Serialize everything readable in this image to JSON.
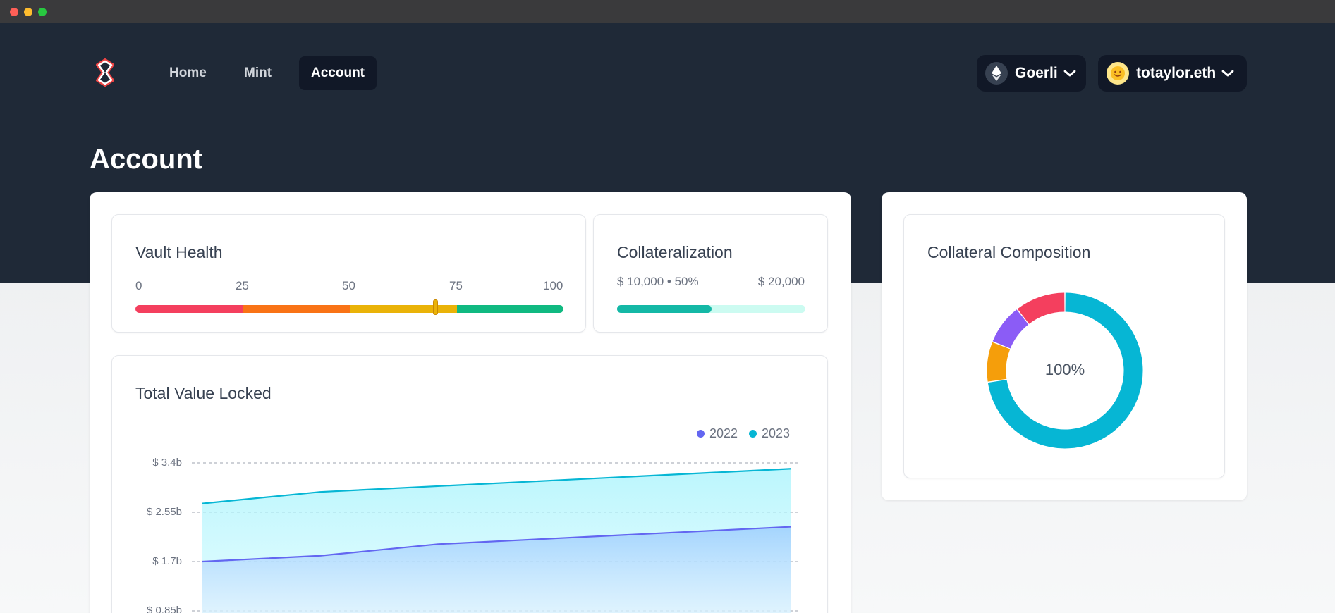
{
  "nav": {
    "items": [
      {
        "label": "Home"
      },
      {
        "label": "Mint"
      },
      {
        "label": "Account"
      }
    ],
    "network_label": "Goerli",
    "account_label": "totaylor.eth"
  },
  "page": {
    "title": "Account"
  },
  "vault_health": {
    "title": "Vault Health",
    "ticks": [
      "0",
      "25",
      "50",
      "75",
      "100"
    ],
    "value": 70,
    "colors": [
      "#f43f5e",
      "#f97316",
      "#eab308",
      "#10b981"
    ]
  },
  "collateralization": {
    "title": "Collateralization",
    "current_label": "$ 10,000 • 50%",
    "max_label": "$ 20,000",
    "percent": 50,
    "fill_color": "#14b8a6",
    "track_color": "#ccfbf1"
  },
  "composition": {
    "title": "Collateral Composition",
    "center_label": "100%",
    "colors": [
      "#06b6d4",
      "#f59e0b",
      "#8b5cf6",
      "#f43f5e"
    ]
  },
  "tvl": {
    "title": "Total Value Locked",
    "legend": [
      {
        "name": "2022",
        "color": "#6366f1"
      },
      {
        "name": "2023",
        "color": "#06b6d4"
      }
    ],
    "y_ticks": [
      "$ 3.4b",
      "$ 2.55b",
      "$ 1.7b",
      "$ 0.85b"
    ]
  },
  "chart_data": [
    {
      "type": "area",
      "title": "Total Value Locked",
      "y_ticks": [
        "$ 0.85b",
        "$ 1.7b",
        "$ 2.55b",
        "$ 3.4b"
      ],
      "ylim": [
        0.85,
        3.4
      ],
      "x": [
        0,
        1,
        2,
        3,
        4,
        5
      ],
      "series": [
        {
          "name": "2023",
          "values": [
            2.7,
            2.9,
            3.0,
            3.1,
            3.2,
            3.3
          ]
        },
        {
          "name": "2022",
          "values": [
            1.7,
            1.8,
            2.0,
            2.1,
            2.2,
            2.3
          ]
        }
      ],
      "grid": true,
      "legend": "top-right"
    },
    {
      "type": "pie",
      "title": "Collateral Composition",
      "values": [
        69,
        8,
        8,
        10
      ],
      "center_label": "100%"
    }
  ]
}
